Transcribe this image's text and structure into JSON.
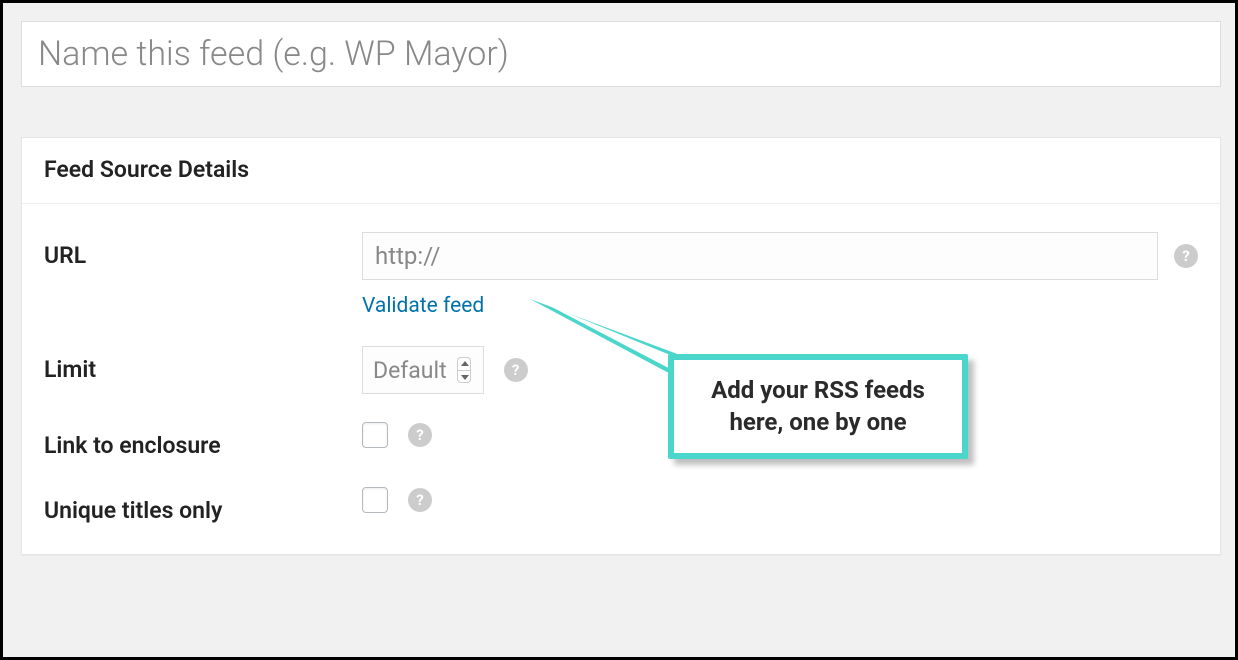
{
  "title_placeholder": "Name this feed (e.g. WP Mayor)",
  "panel": {
    "heading": "Feed Source Details",
    "fields": {
      "url": {
        "label": "URL",
        "placeholder": "http://",
        "validate_link": "Validate feed"
      },
      "limit": {
        "label": "Limit",
        "value": "Default"
      },
      "link_enclosure": {
        "label": "Link to enclosure"
      },
      "unique_titles": {
        "label": "Unique titles only"
      }
    }
  },
  "help_glyph": "?",
  "callout_text": "Add your RSS feeds here, one by one",
  "colors": {
    "accent": "#4bd6cb",
    "link": "#0073aa"
  }
}
